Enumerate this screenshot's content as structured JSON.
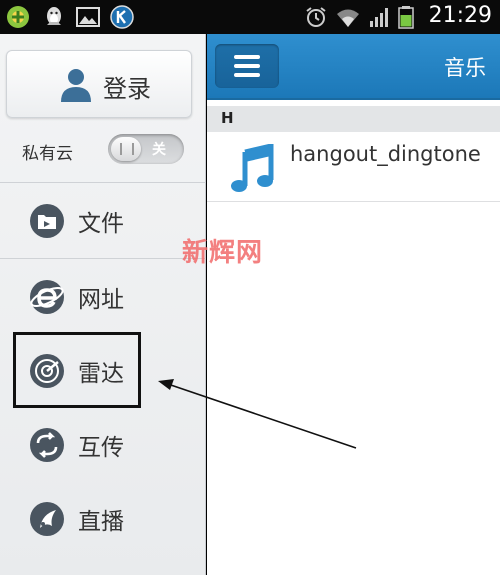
{
  "status_bar": {
    "time": "21:29",
    "left_icons": [
      "game-controller-icon",
      "qq-penguin-icon",
      "gallery-icon",
      "k-app-icon"
    ],
    "right_icons": [
      "alarm-icon",
      "wifi-icon",
      "signal-icon",
      "battery-icon"
    ]
  },
  "sidebar": {
    "login_label": "登录",
    "private_cloud_label": "私有云",
    "toggle_label": "关",
    "items": [
      {
        "label": "文件",
        "icon": "folder-icon"
      },
      {
        "label": "网址",
        "icon": "browser-e-icon"
      },
      {
        "label": "雷达",
        "icon": "radar-icon"
      },
      {
        "label": "互传",
        "icon": "transfer-icon"
      },
      {
        "label": "直播",
        "icon": "broadcast-icon"
      }
    ]
  },
  "main": {
    "title": "音乐",
    "section_letter": "H",
    "songs": [
      {
        "title": "hangout_dingtone",
        "icon": "music-note-icon"
      }
    ]
  },
  "watermark": "新辉网",
  "colors": {
    "accent": "#1c78b8",
    "icon_dark": "#4a5560",
    "music_icon": "#2f8fcf",
    "watermark": "#f26a6a"
  }
}
